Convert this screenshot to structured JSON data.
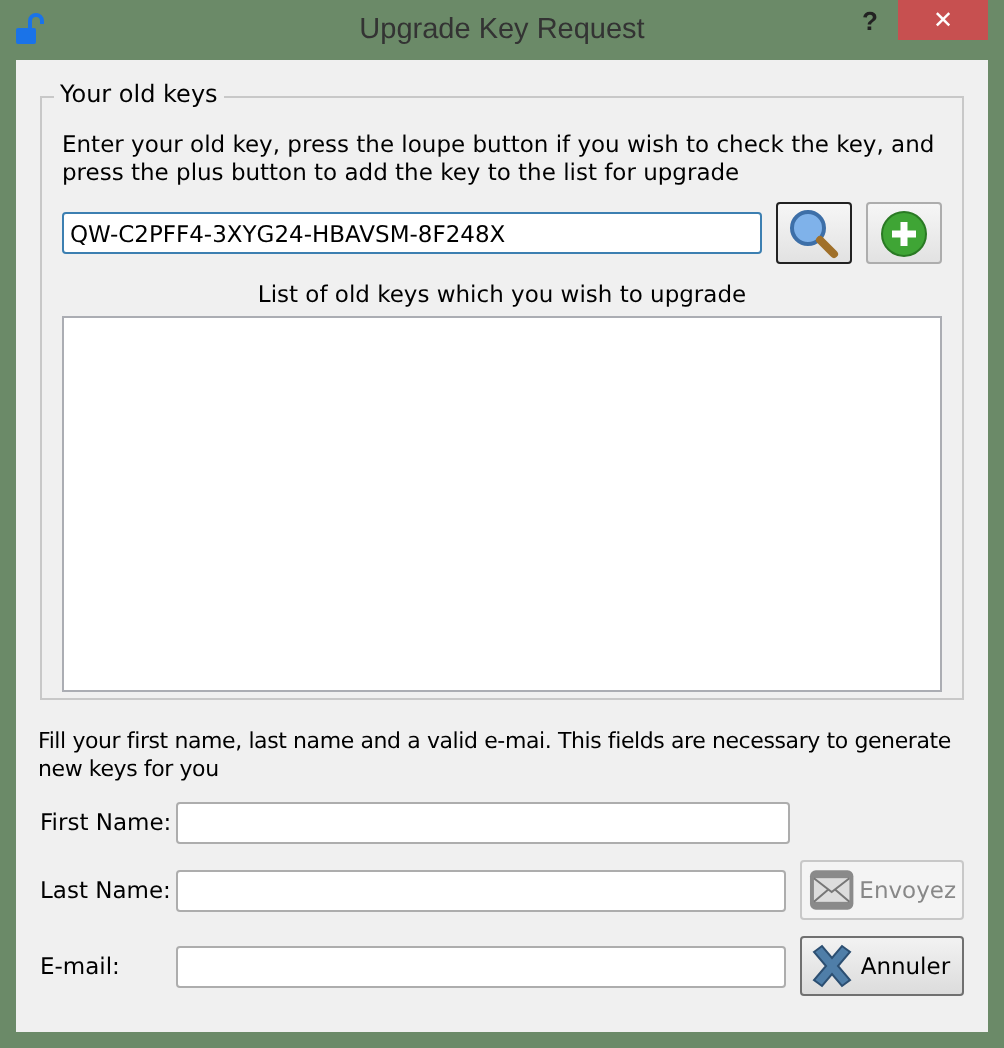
{
  "window": {
    "title": "Upgrade Key Request",
    "help": "?",
    "close": "✕"
  },
  "old_keys": {
    "title": "Your old keys",
    "instructions": "Enter your old key, press the loupe button if you wish to check the key, and press the plus button to add the key to the list for upgrade",
    "key_value": "QW-C2PFF4-3XYG24-HBAVSM-8F248X",
    "list_label": "List of old keys which you wish to upgrade"
  },
  "info": "Fill your first name, last name and a valid e-mai. This fields are necessary to generate new keys for you",
  "fields": [
    {
      "label": "First Name:"
    },
    {
      "label": "Last Name:"
    },
    {
      "label": "E-mail:"
    }
  ],
  "buttons": [
    {
      "label": "Envoyez",
      "kind": "send",
      "disabled": true
    },
    {
      "label": "Annuler",
      "kind": "cancel",
      "disabled": false
    }
  ]
}
